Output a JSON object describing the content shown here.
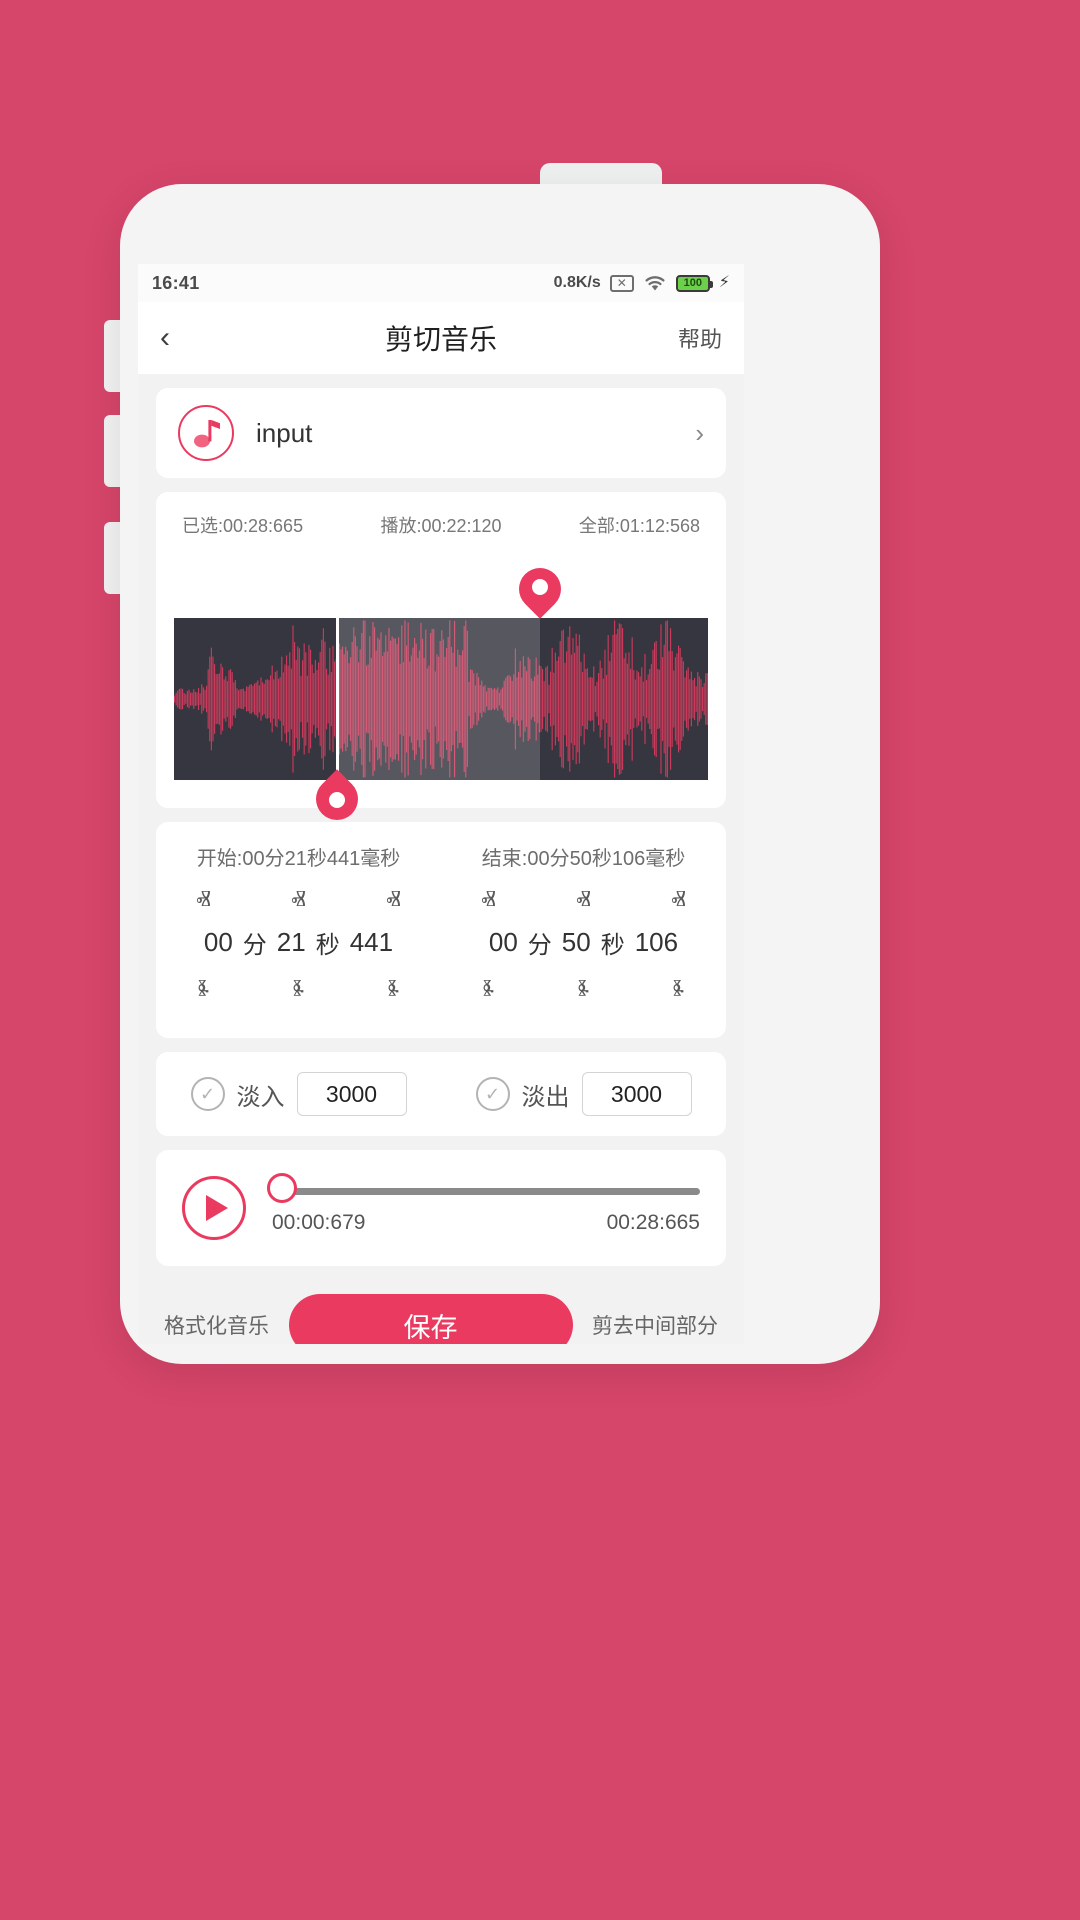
{
  "status": {
    "time": "16:41",
    "net_speed": "0.8K/s",
    "sim_icon": "sim-card-disabled-icon",
    "sim_glyph": "✕",
    "wifi_icon": "wifi-icon",
    "battery_level": "100",
    "charging_glyph": "⚡"
  },
  "nav": {
    "back_glyph": "‹",
    "title": "剪切音乐",
    "help_label": "帮助"
  },
  "file": {
    "icon": "music-note-icon",
    "name": "input",
    "arrow_glyph": "›"
  },
  "times": {
    "selected": "已选:00:28:665",
    "playing": "播放:00:22:120",
    "total": "全部:01:12:568"
  },
  "waveform": {
    "selection_start_pct": 30.5,
    "selection_end_pct": 68.5,
    "start_marker_label": "start-handle",
    "end_marker_label": "end-handle"
  },
  "stepper": {
    "start_label": "开始:00分21秒441毫秒",
    "end_label": "结束:00分50秒106毫秒",
    "up_glyph": "ⱏ",
    "down_glyph": "ⱛ",
    "start": {
      "minutes": "00",
      "min_unit": "分",
      "seconds": "21",
      "sec_unit": "秒",
      "millis": "441"
    },
    "end": {
      "minutes": "00",
      "min_unit": "分",
      "seconds": "50",
      "sec_unit": "秒",
      "millis": "106"
    }
  },
  "fade": {
    "check_glyph": "✓",
    "in_label": "淡入",
    "in_value": "3000",
    "out_label": "淡出",
    "out_value": "3000"
  },
  "player": {
    "play_icon": "play-icon",
    "progress_pct": 2,
    "current_time": "00:00:679",
    "end_time": "00:28:665"
  },
  "bottom": {
    "format_label": "格式化音乐",
    "save_label": "保存",
    "trim_middle_label": "剪去中间部分"
  },
  "colors": {
    "background": "#d6456a",
    "accent": "#ea3a60",
    "wave_dark": "#35363f",
    "wave_red": "#c93a5c",
    "battery_green": "#6cd04a"
  }
}
